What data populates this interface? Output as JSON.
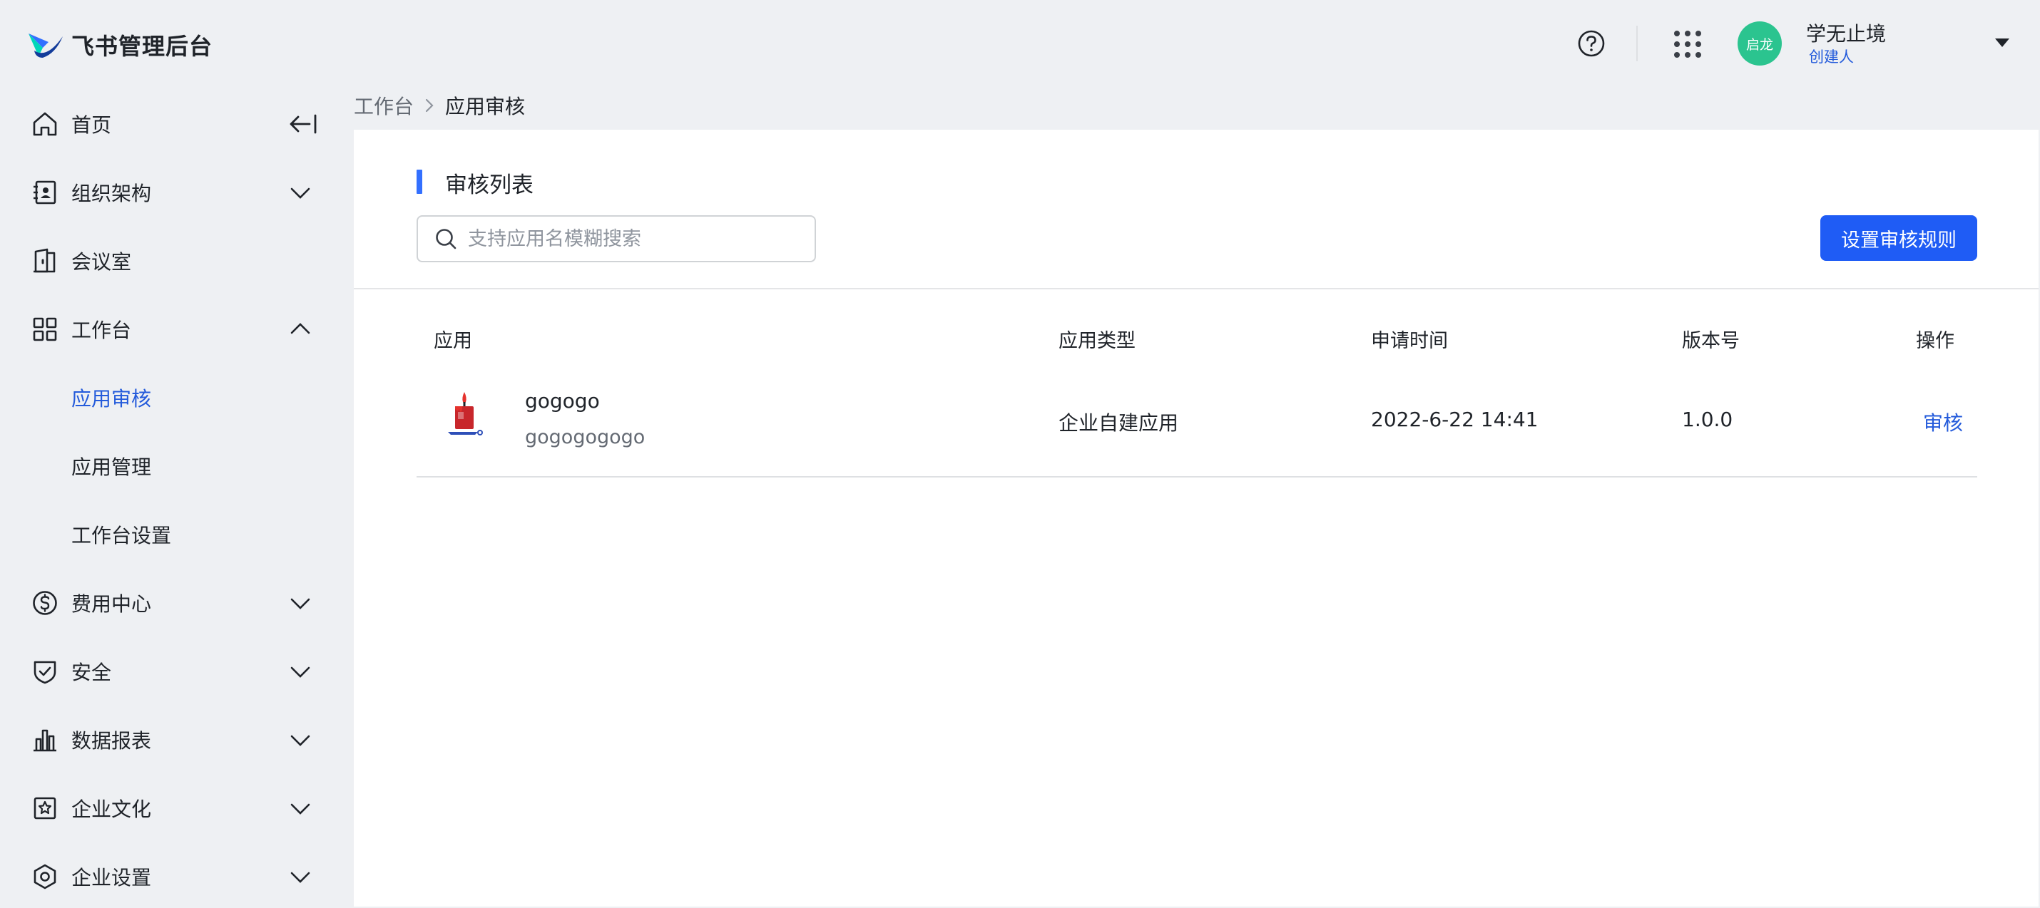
{
  "header": {
    "brand": "飞书管理后台",
    "user": {
      "avatar_text": "启龙",
      "name": "学无止境",
      "role": "创建人"
    }
  },
  "sidebar": {
    "items": [
      {
        "label": "首页",
        "icon": "home-icon"
      },
      {
        "label": "组织架构",
        "icon": "org-icon"
      },
      {
        "label": "会议室",
        "icon": "meeting-room-icon"
      },
      {
        "label": "工作台",
        "icon": "workbench-icon"
      },
      {
        "label": "应用审核"
      },
      {
        "label": "应用管理"
      },
      {
        "label": "工作台设置"
      },
      {
        "label": "费用中心",
        "icon": "dollar-icon"
      },
      {
        "label": "安全",
        "icon": "shield-icon"
      },
      {
        "label": "数据报表",
        "icon": "bar-chart-icon"
      },
      {
        "label": "企业文化",
        "icon": "culture-icon"
      },
      {
        "label": "企业设置",
        "icon": "settings-icon"
      }
    ]
  },
  "breadcrumb": {
    "parent": "工作台",
    "current": "应用审核"
  },
  "main": {
    "title": "审核列表",
    "search": {
      "placeholder": "支持应用名模糊搜索",
      "value": ""
    },
    "rule_button": "设置审核规则",
    "table": {
      "columns": [
        "应用",
        "应用类型",
        "申请时间",
        "版本号",
        "操作"
      ],
      "rows": [
        {
          "name": "gogogo",
          "description": "gogogogogo",
          "type": "企业自建应用",
          "time": "2022-6-22 14:41",
          "version": "1.0.0",
          "action": "审核"
        }
      ]
    }
  },
  "colors": {
    "accent": "#245bdb",
    "primary_button": "#1f5cf5",
    "avatar": "#2bc48f"
  }
}
